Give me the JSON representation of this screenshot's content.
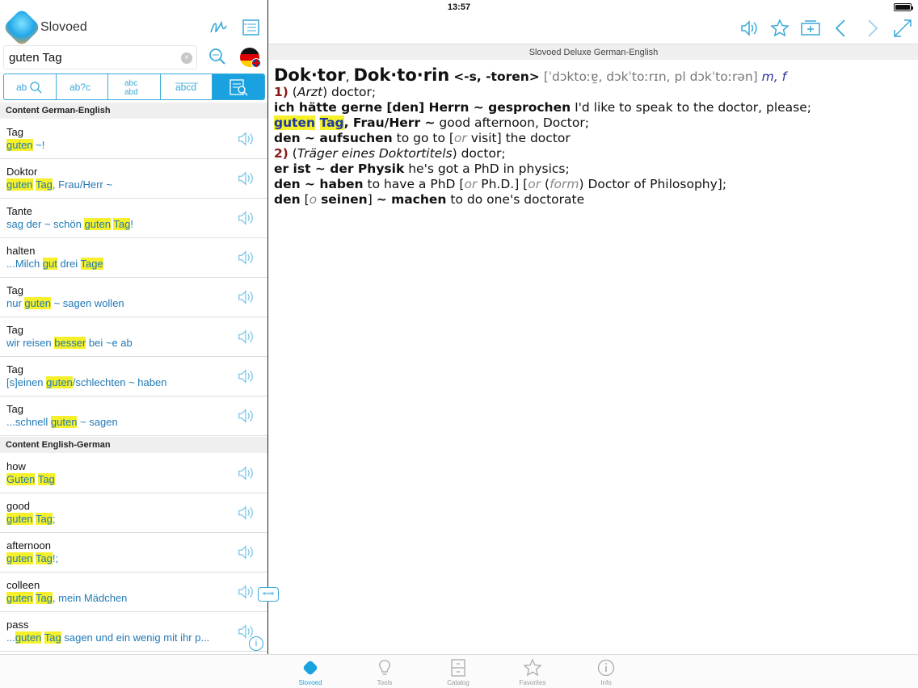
{
  "status": {
    "device": "iPad",
    "time": "13:57"
  },
  "app": {
    "name": "Slovoed"
  },
  "search": {
    "value": "guten Tag",
    "clear_glyph": "×"
  },
  "modes": [
    {
      "label": "a▭ search",
      "icon": "fuzzy-search-icon"
    },
    {
      "label": "ab?c",
      "icon": "wildcard-search-icon"
    },
    {
      "label": "abc/abd",
      "icon": "anagram-icon"
    },
    {
      "label": "abcd",
      "icon": "spelling-icon"
    },
    {
      "label": "fulltext",
      "icon": "full-text-search-icon"
    }
  ],
  "sections": [
    {
      "title": "Content German-English"
    },
    {
      "title": "Content English-German"
    }
  ],
  "results_de": [
    {
      "headword": "Tag",
      "example_html": "<span class=\"hl\">guten</span> ~!"
    },
    {
      "headword": "Doktor",
      "example_html": "<span class=\"hl\">guten</span> <span class=\"hl\">Tag</span>, Frau/Herr ~"
    },
    {
      "headword": "Tante",
      "example_html": "sag der ~ schön <span class=\"hl\">guten</span> <span class=\"hl\">Tag</span>!"
    },
    {
      "headword": "halten",
      "example_html": "...Milch <span class=\"hl\">gut</span> drei <span class=\"hl\">Tage</span>"
    },
    {
      "headword": "Tag",
      "example_html": "nur <span class=\"hl\">guten</span> ~ sagen wollen"
    },
    {
      "headword": "Tag",
      "example_html": "wir reisen <span class=\"hl\">besser</span> bei ~e ab"
    },
    {
      "headword": "Tag",
      "example_html": "[s]einen <span class=\"hl\">guten</span>/schlechten ~ haben"
    },
    {
      "headword": "Tag",
      "example_html": "...schnell <span class=\"hl\">guten</span> ~ sagen"
    }
  ],
  "results_en": [
    {
      "headword": "how",
      "example_html": "<span class=\"hl\">Guten</span> <span class=\"hl\">Tag</span>"
    },
    {
      "headword": "good",
      "example_html": "<span class=\"hl\">guten</span> <span class=\"hl\">Tag</span>;"
    },
    {
      "headword": "afternoon",
      "example_html": "<span class=\"hl\">guten</span> <span class=\"hl\">Tag</span>!;"
    },
    {
      "headword": "colleen",
      "example_html": "<span class=\"hl\">guten</span> <span class=\"hl\">Tag</span>, mein Mädchen"
    },
    {
      "headword": "pass",
      "example_html": "...<span class=\"hl\">guten</span> <span class=\"hl\">Tag</span> sagen und ein wenig mit ihr p..."
    }
  ],
  "dictionary_title": "Slovoed Deluxe German-English",
  "article": {
    "headword_1": "Dok·tor",
    "headword_2": "Dok·to·rin",
    "grammar": "<-s, -toren>",
    "pronunciation": "[ˈdɔktoːɐ̯, dɔkˈtoːrɪn, pl dɔkˈtoːrən]",
    "gender": "m, f",
    "lines_html": [
      "<span class=\"num\">1)</span> (<span class=\"i\">Arzt</span>) doctor;",
      "<span class=\"b\">ich hätte gerne [den] Herrn ~ gesprochen</span> I'd like to speak to the doctor, please;",
      "<span class=\"b\"><span class=\"hl2\">guten</span> <span class=\"hl2\">Tag</span>, Frau/Herr ~</span> good afternoon, Doctor;",
      "<span class=\"b\">den ~ aufsuchen</span> to go to [<span class=\"gray\">or</span> visit] the doctor",
      "<span class=\"num\">2)</span> (<span class=\"i\">Träger eines Doktortitels</span>) doctor;",
      "<span class=\"b\">er ist ~ der Physik</span> he's got a PhD in physics;",
      "<span class=\"b\">den ~ haben</span> to have a PhD [<span class=\"gray\">or</span> Ph.D.] [<span class=\"gray\">or</span> (<span class=\"gray\">form</span>) Doctor of Philosophy];",
      "<span class=\"b\">den</span> [<span class=\"gray\">o</span> <span class=\"b\">seinen</span>] <span class=\"b\">~ machen</span> to do one's doctorate"
    ]
  },
  "tabs": [
    {
      "label": "Slovoed",
      "icon": "slovoed-icon",
      "active": true
    },
    {
      "label": "Tools",
      "icon": "lightbulb-icon",
      "active": false
    },
    {
      "label": "Catalog",
      "icon": "catalog-icon",
      "active": false
    },
    {
      "label": "Favorites",
      "icon": "star-icon",
      "active": false
    },
    {
      "label": "Info",
      "icon": "info-icon",
      "active": false
    }
  ],
  "colors": {
    "accent": "#1aa2e0",
    "highlight": "#f6f02a",
    "example_text": "#1f79b5",
    "sense_number": "#8b1a1a"
  }
}
